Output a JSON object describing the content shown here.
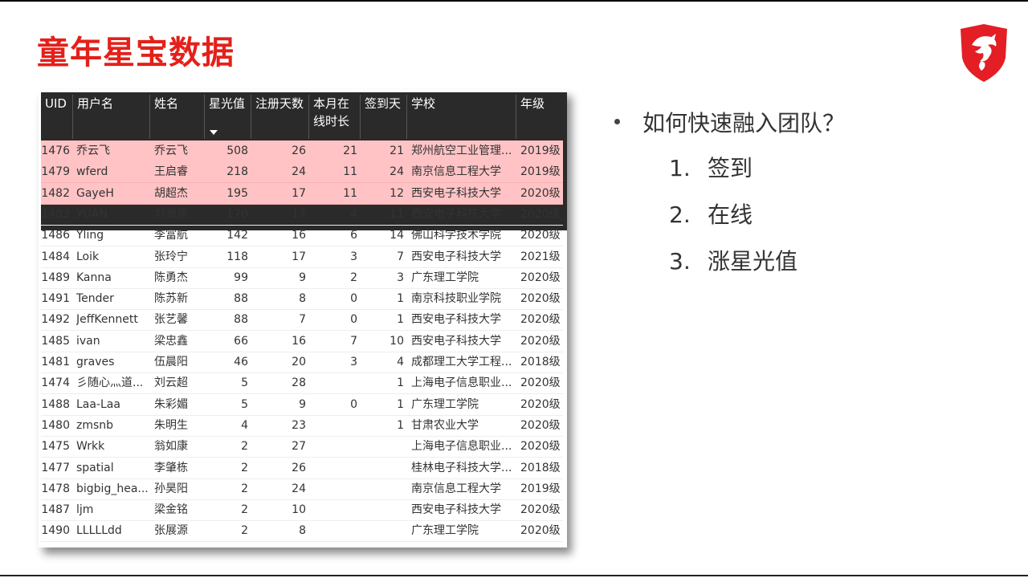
{
  "slide": {
    "title": "童年星宝数据"
  },
  "table": {
    "headers": [
      "UID",
      "用户名",
      "姓名",
      "星光值",
      "注册天数",
      "本月在线时长",
      "签到天",
      "学校",
      "年级"
    ],
    "header_lines": {
      "online": [
        "本月在",
        "线时长"
      ]
    },
    "sorted_column": "星光值",
    "rows": [
      {
        "uid": "1476",
        "user": "乔云飞",
        "name": "乔云飞",
        "star": "508",
        "days": "26",
        "online": "21",
        "checkin": "21",
        "school": "郑州航空工业管理...",
        "grade": "2019级",
        "highlight": true
      },
      {
        "uid": "1479",
        "user": "wferd",
        "name": "王启睿",
        "star": "218",
        "days": "24",
        "online": "11",
        "checkin": "24",
        "school": "南京信息工程大学",
        "grade": "2019级",
        "highlight": true
      },
      {
        "uid": "1482",
        "user": "GayeH",
        "name": "胡超杰",
        "star": "195",
        "days": "17",
        "online": "11",
        "checkin": "12",
        "school": "西安电子科技大学",
        "grade": "2020级",
        "highlight": true
      },
      {
        "uid": "1483",
        "user": "YUAN",
        "name": "刘瀚原",
        "star": "170",
        "days": "17",
        "online": "4",
        "checkin": "11",
        "school": "西安电子科技大学",
        "grade": "2020级",
        "highlight": false
      },
      {
        "uid": "1486",
        "user": "Yling",
        "name": "李富航",
        "star": "142",
        "days": "16",
        "online": "6",
        "checkin": "14",
        "school": "佛山科学技术学院",
        "grade": "2020级",
        "highlight": false
      },
      {
        "uid": "1484",
        "user": "Loik",
        "name": "张玲宁",
        "star": "118",
        "days": "17",
        "online": "3",
        "checkin": "7",
        "school": "西安电子科技大学",
        "grade": "2021级",
        "highlight": false
      },
      {
        "uid": "1489",
        "user": "Kanna",
        "name": "陈勇杰",
        "star": "99",
        "days": "9",
        "online": "2",
        "checkin": "3",
        "school": "广东理工学院",
        "grade": "2020级",
        "highlight": false
      },
      {
        "uid": "1491",
        "user": "Tender",
        "name": "陈苏新",
        "star": "88",
        "days": "8",
        "online": "0",
        "checkin": "1",
        "school": "南京科技职业学院",
        "grade": "2020级",
        "highlight": false
      },
      {
        "uid": "1492",
        "user": "JeffKennett",
        "name": "张艺馨",
        "star": "88",
        "days": "7",
        "online": "0",
        "checkin": "1",
        "school": "西安电子科技大学",
        "grade": "2020级",
        "highlight": false
      },
      {
        "uid": "1485",
        "user": "ivan",
        "name": "梁忠鑫",
        "star": "66",
        "days": "16",
        "online": "7",
        "checkin": "10",
        "school": "西安电子科技大学",
        "grade": "2020级",
        "highlight": false
      },
      {
        "uid": "1481",
        "user": "graves",
        "name": "伍晨阳",
        "star": "46",
        "days": "20",
        "online": "3",
        "checkin": "4",
        "school": "成都理工大学工程...",
        "grade": "2018级",
        "highlight": false
      },
      {
        "uid": "1474",
        "user": "彡随心灬道...",
        "name": "刘云超",
        "star": "5",
        "days": "28",
        "online": "",
        "checkin": "1",
        "school": "上海电子信息职业...",
        "grade": "2020级",
        "highlight": false
      },
      {
        "uid": "1488",
        "user": "Laa-Laa",
        "name": "朱彩媚",
        "star": "5",
        "days": "9",
        "online": "0",
        "checkin": "1",
        "school": "广东理工学院",
        "grade": "2020级",
        "highlight": false
      },
      {
        "uid": "1480",
        "user": "zmsnb",
        "name": "朱明生",
        "star": "4",
        "days": "23",
        "online": "",
        "checkin": "1",
        "school": "甘肃农业大学",
        "grade": "2020级",
        "highlight": false
      },
      {
        "uid": "1475",
        "user": "Wrkk",
        "name": "翁如康",
        "star": "2",
        "days": "27",
        "online": "",
        "checkin": "",
        "school": "上海电子信息职业...",
        "grade": "2020级",
        "highlight": false
      },
      {
        "uid": "1477",
        "user": "spatial",
        "name": "李肇栋",
        "star": "2",
        "days": "26",
        "online": "",
        "checkin": "",
        "school": "桂林电子科技大学...",
        "grade": "2018级",
        "highlight": false
      },
      {
        "uid": "1478",
        "user": "bigbig_hea...",
        "name": "孙昊阳",
        "star": "2",
        "days": "24",
        "online": "",
        "checkin": "",
        "school": "南京信息工程大学",
        "grade": "2019级",
        "highlight": false
      },
      {
        "uid": "1487",
        "user": "ljm",
        "name": "梁金铭",
        "star": "2",
        "days": "10",
        "online": "",
        "checkin": "",
        "school": "西安电子科技大学",
        "grade": "2020级",
        "highlight": false
      },
      {
        "uid": "1490",
        "user": "LLLLLdd",
        "name": "张展源",
        "star": "2",
        "days": "8",
        "online": "",
        "checkin": "",
        "school": "广东理工学院",
        "grade": "2020级",
        "highlight": false
      }
    ]
  },
  "bullets": {
    "question": "如何快速融入团队？",
    "steps": [
      {
        "num": "1.",
        "text": "签到"
      },
      {
        "num": "2.",
        "text": "在线"
      },
      {
        "num": "3.",
        "text": "涨星光值"
      }
    ]
  },
  "colors": {
    "title_red": "#e4201a",
    "highlight_row": "#ffc3c5",
    "header_bg": "#2a2a2a",
    "logo_red": "#e31e24"
  },
  "icons": {
    "logo": "dragon-shield-icon"
  }
}
